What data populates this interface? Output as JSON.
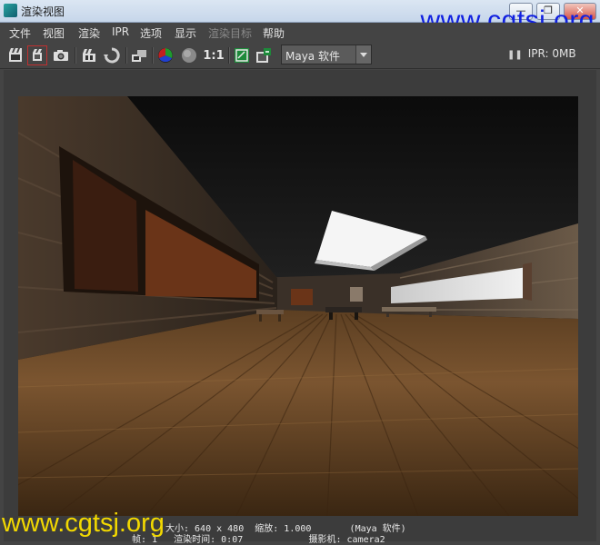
{
  "window": {
    "title": "渲染视图",
    "buttons": {
      "minimize": "—",
      "restore": "❐",
      "close": "✕"
    }
  },
  "menubar": {
    "items": [
      {
        "label": "文件",
        "disabled": false
      },
      {
        "label": "视图",
        "disabled": false
      },
      {
        "label": "渲染",
        "disabled": false
      },
      {
        "label": "IPR",
        "disabled": false
      },
      {
        "label": "选项",
        "disabled": false
      },
      {
        "label": "显示",
        "disabled": false
      },
      {
        "label": "渲染目标",
        "disabled": true
      },
      {
        "label": "帮助",
        "disabled": false
      }
    ]
  },
  "toolbar": {
    "ratio_label": "1:1",
    "renderer_select": "Maya 软件",
    "ipr_pause": "❚❚",
    "ipr_memory": "IPR: 0MB"
  },
  "render_info": {
    "line1": "大小: 640 x 480  缩放: 1.000       (Maya 软件)",
    "line2": "帧: 1   渲染时间: 0:07            摄影机: camera2"
  },
  "watermarks": {
    "top": "www.cgtsj.org",
    "bottom": "www.cgtsj.org"
  },
  "colors": {
    "ui_background": "#444444",
    "title_bar": "#c6d6ea",
    "watermark_top": "#1020e0",
    "watermark_bottom": "#f2d800",
    "selected_icon_outline": "#c03030"
  }
}
